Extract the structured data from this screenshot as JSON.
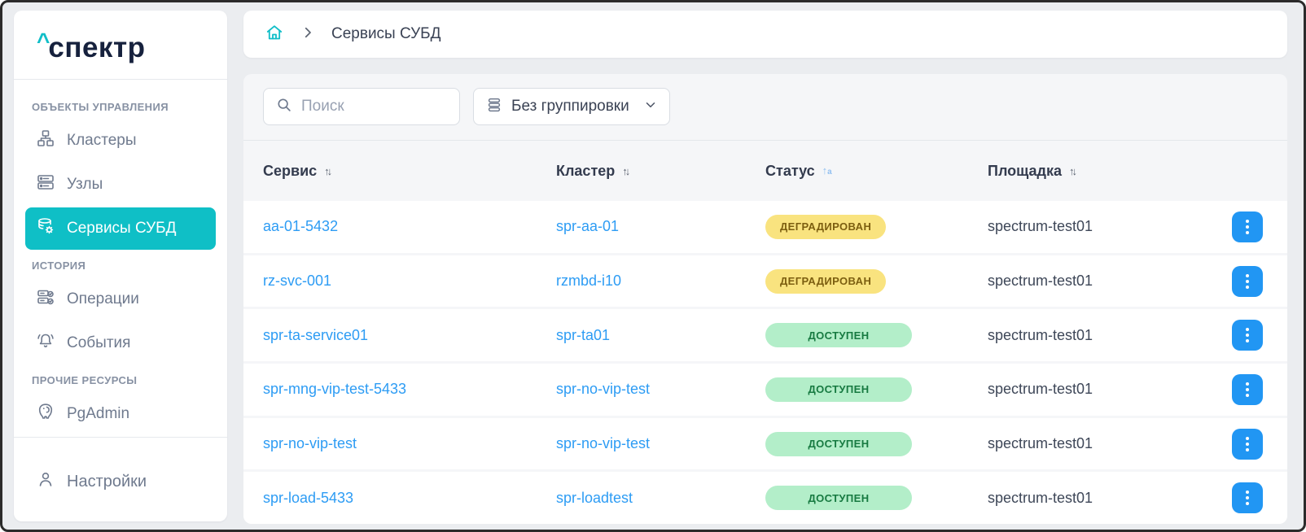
{
  "brand": {
    "caret": "^",
    "name": "спектр"
  },
  "sidebar": {
    "sections": [
      {
        "label": "ОБЪЕКТЫ УПРАВЛЕНИЯ",
        "items": [
          {
            "label": "Кластеры",
            "icon": "clusters-icon",
            "active": false
          },
          {
            "label": "Узлы",
            "icon": "nodes-icon",
            "active": false
          },
          {
            "label": "Сервисы СУБД",
            "icon": "db-services-icon",
            "active": true
          }
        ]
      },
      {
        "label": "ИСТОРИЯ",
        "items": [
          {
            "label": "Операции",
            "icon": "operations-icon",
            "active": false
          },
          {
            "label": "События",
            "icon": "events-icon",
            "active": false
          }
        ]
      },
      {
        "label": "ПРОЧИЕ РЕСУРСЫ",
        "items": [
          {
            "label": "PgAdmin",
            "icon": "pgadmin-icon",
            "active": false
          }
        ]
      }
    ],
    "footer": {
      "label": "Настройки",
      "icon": "user-icon"
    }
  },
  "breadcrumb": {
    "current": "Сервисы СУБД"
  },
  "toolbar": {
    "search_placeholder": "Поиск",
    "grouping_label": "Без группировки"
  },
  "table": {
    "columns": [
      {
        "label": "Сервис",
        "sort": "none"
      },
      {
        "label": "Кластер",
        "sort": "none"
      },
      {
        "label": "Статус",
        "sort": "asc"
      },
      {
        "label": "Площадка",
        "sort": "none"
      }
    ],
    "rows": [
      {
        "service": "aa-01-5432",
        "cluster": "spr-aa-01",
        "status": "ДЕГРАДИРОВАН",
        "status_type": "degraded",
        "site": "spectrum-test01"
      },
      {
        "service": "rz-svc-001",
        "cluster": "rzmbd-i10",
        "status": "ДЕГРАДИРОВАН",
        "status_type": "degraded",
        "site": "spectrum-test01"
      },
      {
        "service": "spr-ta-service01",
        "cluster": "spr-ta01",
        "status": "ДОСТУПЕН",
        "status_type": "available",
        "site": "spectrum-test01"
      },
      {
        "service": "spr-mng-vip-test-5433",
        "cluster": "spr-no-vip-test",
        "status": "ДОСТУПЕН",
        "status_type": "available",
        "site": "spectrum-test01"
      },
      {
        "service": "spr-no-vip-test",
        "cluster": "spr-no-vip-test",
        "status": "ДОСТУПЕН",
        "status_type": "available",
        "site": "spectrum-test01"
      },
      {
        "service": "spr-load-5433",
        "cluster": "spr-loadtest",
        "status": "ДОСТУПЕН",
        "status_type": "available",
        "site": "spectrum-test01"
      }
    ]
  },
  "colors": {
    "accent_teal": "#0fbfc6",
    "link_blue": "#2d9cf4",
    "action_button_blue": "#2196f3",
    "badge_degraded_bg": "#f9e37f",
    "badge_degraded_text": "#7c5e10",
    "badge_available_bg": "#b3eec9",
    "badge_available_text": "#177a41",
    "sidebar_text": "#6f7a8e",
    "page_background": "#ebedf0",
    "panel_background": "#f5f6f8"
  }
}
